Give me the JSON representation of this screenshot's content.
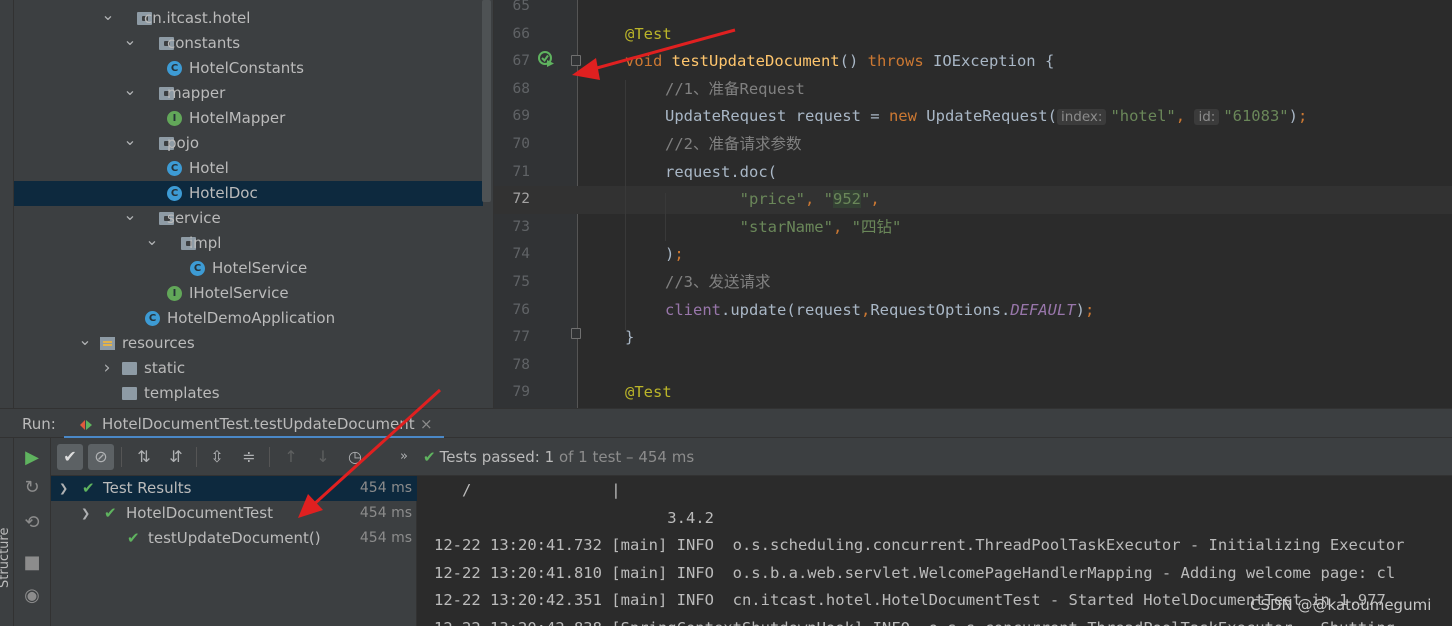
{
  "project_tree": {
    "items": [
      {
        "label": "cn.itcast.hotel",
        "kind": "package",
        "expanded": true,
        "icon": "package-icon"
      },
      {
        "label": "constants",
        "kind": "package",
        "expanded": true,
        "icon": "package-icon"
      },
      {
        "label": "HotelConstants",
        "kind": "class",
        "icon": "class-icon",
        "badge": "C"
      },
      {
        "label": "mapper",
        "kind": "package",
        "expanded": true,
        "icon": "package-icon"
      },
      {
        "label": "HotelMapper",
        "kind": "interface",
        "icon": "interface-icon",
        "badge": "I"
      },
      {
        "label": "pojo",
        "kind": "package",
        "expanded": true,
        "icon": "package-icon"
      },
      {
        "label": "Hotel",
        "kind": "class",
        "icon": "class-icon",
        "badge": "C"
      },
      {
        "label": "HotelDoc",
        "kind": "class",
        "icon": "class-icon",
        "badge": "C",
        "selected": true
      },
      {
        "label": "service",
        "kind": "package",
        "expanded": true,
        "icon": "package-icon"
      },
      {
        "label": "impl",
        "kind": "package",
        "expanded": true,
        "icon": "package-icon"
      },
      {
        "label": "HotelService",
        "kind": "class",
        "icon": "class-icon",
        "badge": "C"
      },
      {
        "label": "IHotelService",
        "kind": "interface",
        "icon": "interface-icon",
        "badge": "I"
      },
      {
        "label": "HotelDemoApplication",
        "kind": "spring-class",
        "icon": "spring-boot-class-icon",
        "badge": "C"
      },
      {
        "label": "resources",
        "kind": "resources",
        "expanded": true,
        "icon": "resources-folder-icon"
      },
      {
        "label": "static",
        "kind": "folder",
        "expanded": false,
        "icon": "folder-icon"
      },
      {
        "label": "templates",
        "kind": "folder",
        "icon": "folder-icon"
      }
    ]
  },
  "editor": {
    "line_numbers": [
      "65",
      "66",
      "67",
      "68",
      "69",
      "70",
      "71",
      "72",
      "73",
      "74",
      "75",
      "76",
      "77",
      "78",
      "79"
    ],
    "current_line": "72",
    "lines": [
      [],
      [
        {
          "t": "@Test",
          "c": "an"
        }
      ],
      [
        {
          "t": "void ",
          "c": "k"
        },
        {
          "t": "testUpdateDocument",
          "c": "fn"
        },
        {
          "t": "() ",
          "c": "pl"
        },
        {
          "t": "throws ",
          "c": "k"
        },
        {
          "t": "IOException {",
          "c": "pl"
        }
      ],
      [
        {
          "t": "//1、准备Request",
          "c": "cm"
        }
      ],
      [
        {
          "t": "UpdateRequest request = ",
          "c": "pl"
        },
        {
          "t": "new ",
          "c": "k"
        },
        {
          "t": "UpdateRequest(",
          "c": "pl"
        },
        {
          "t": "index:",
          "c": "hint"
        },
        {
          "t": "\"hotel\"",
          "c": "st"
        },
        {
          "t": ", ",
          "c": "k"
        },
        {
          "t": "id:",
          "c": "hint"
        },
        {
          "t": "\"61083\"",
          "c": "st"
        },
        {
          "t": ")",
          "c": "pl"
        },
        {
          "t": ";",
          "c": "k"
        }
      ],
      [
        {
          "t": "//2、准备请求参数",
          "c": "cm"
        }
      ],
      [
        {
          "t": "request.doc(",
          "c": "pl"
        }
      ],
      [
        {
          "t": "        \"price\"",
          "c": "st"
        },
        {
          "t": ", ",
          "c": "k"
        },
        {
          "t": "\"",
          "c": "st"
        },
        {
          "t": "952",
          "c": "st hl"
        },
        {
          "t": "\"",
          "c": "st"
        },
        {
          "t": ",",
          "c": "k"
        }
      ],
      [
        {
          "t": "        \"starName\"",
          "c": "st"
        },
        {
          "t": ", ",
          "c": "k"
        },
        {
          "t": "\"四钻\"",
          "c": "st"
        }
      ],
      [
        {
          "t": ")",
          "c": "pl"
        },
        {
          "t": ";",
          "c": "k"
        }
      ],
      [
        {
          "t": "//3、发送请求",
          "c": "cm"
        }
      ],
      [
        {
          "t": "client",
          "c": "fld"
        },
        {
          "t": ".update(request",
          "c": "pl"
        },
        {
          "t": ",",
          "c": "k"
        },
        {
          "t": "RequestOptions.",
          "c": "pl"
        },
        {
          "t": "DEFAULT",
          "c": "fldi"
        },
        {
          "t": ")",
          "c": "pl"
        },
        {
          "t": ";",
          "c": "k"
        }
      ],
      [
        {
          "t": "}",
          "c": "pl"
        }
      ],
      [],
      [
        {
          "t": "@Test",
          "c": "an"
        }
      ]
    ]
  },
  "run_panel": {
    "label": "Run:",
    "tab_title": "HotelDocumentTest.testUpdateDocument",
    "status": {
      "prefix": "Tests passed: ",
      "count": "1",
      "suffix": " of 1 test – 454 ms"
    },
    "results": [
      {
        "label": "Test Results",
        "time": "454 ms",
        "selected": true
      },
      {
        "label": "HotelDocumentTest",
        "time": "454 ms"
      },
      {
        "label": "testUpdateDocument()",
        "time": "454 ms"
      }
    ],
    "console_lines": [
      "   /               |",
      "                         3.4.2",
      "12-22 13:20:41.732 [main] INFO  o.s.scheduling.concurrent.ThreadPoolTaskExecutor - Initializing Executor",
      "12-22 13:20:41.810 [main] INFO  o.s.b.a.web.servlet.WelcomePageHandlerMapping - Adding welcome page: cl",
      "12-22 13:20:42.351 [main] INFO  cn.itcast.hotel.HotelDocumentTest - Started HotelDocumentTest in 1.977",
      "12-22 13:20:42.838 [SpringContextShutdownHook] INFO  o.s.s.concurrent.ThreadPoolTaskExecutor - Shutting"
    ],
    "side_label": "Structure"
  },
  "watermark": "CSDN @@katoumegumi",
  "colors": {
    "accent": "#4a88c7",
    "pass_green": "#5fb35f",
    "annotation_arrow": "#e02020"
  }
}
